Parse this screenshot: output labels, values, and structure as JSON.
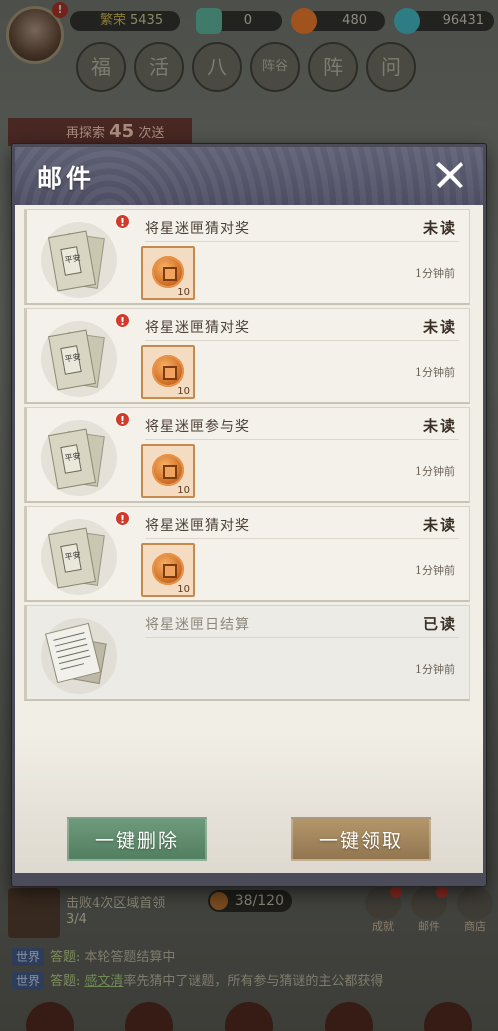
{
  "top": {
    "fame_label": "繁荣",
    "fame_value": "5435",
    "jade_value": "0",
    "coin_value": "480",
    "gem_value": "96431",
    "avatar_badge": "!",
    "circle_buttons": [
      "福",
      "活",
      "八",
      "阵谷",
      "阵",
      "问"
    ],
    "explore_text": "再探索",
    "explore_count": "45",
    "explore_suffix": "次送"
  },
  "modal": {
    "title": "邮件",
    "mails": [
      {
        "title": "将星迷匣猜对奖",
        "status": "未读",
        "time": "1分钟前",
        "reward_qty": "10",
        "unread": true
      },
      {
        "title": "将星迷匣猜对奖",
        "status": "未读",
        "time": "1分钟前",
        "reward_qty": "10",
        "unread": true
      },
      {
        "title": "将星迷匣参与奖",
        "status": "未读",
        "time": "1分钟前",
        "reward_qty": "10",
        "unread": true
      },
      {
        "title": "将星迷匣猜对奖",
        "status": "未读",
        "time": "1分钟前",
        "reward_qty": "10",
        "unread": true
      },
      {
        "title": "将星迷匣日结算",
        "status": "已读",
        "time": "1分钟前",
        "reward_qty": "",
        "unread": false
      }
    ],
    "unread_badge": "!",
    "delete_all_label": "一键删除",
    "claim_all_label": "一键领取"
  },
  "task": {
    "title": "击败4次区域首领",
    "progress": "3/4",
    "counter": "38/120"
  },
  "side_icons": [
    "成就",
    "邮件",
    "商店"
  ],
  "chat": [
    {
      "tag": "世界",
      "prefix": "答题:",
      "text": "本轮答题结算中"
    },
    {
      "tag": "世界",
      "prefix": "答题:",
      "name": "感文清",
      "text": "率先猜中了谜题，所有参与猜谜的主公都获得"
    }
  ],
  "colors": {
    "header": "#4c4d62",
    "delete_button": "#537f61",
    "claim_button": "#927650",
    "unread_dot": "#d23a2a"
  }
}
